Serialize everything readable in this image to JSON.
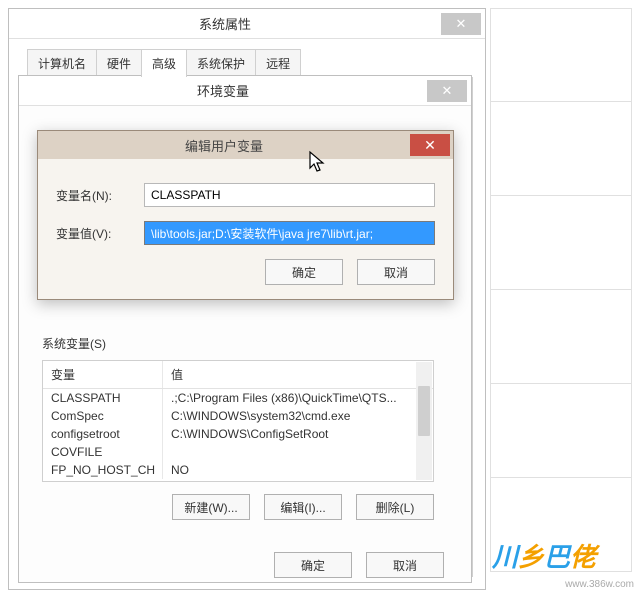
{
  "win1": {
    "title": "系统属性",
    "tabs": [
      "计算机名",
      "硬件",
      "高级",
      "系统保护",
      "远程"
    ],
    "active_tab": 2
  },
  "win2": {
    "title": "环境变量"
  },
  "win3": {
    "title": "编辑用户变量",
    "name_label": "变量名(N):",
    "name_value": "CLASSPATH",
    "value_label": "变量值(V):",
    "value_value": "\\lib\\tools.jar;D:\\安装软件\\java jre7\\lib\\rt.jar;",
    "ok": "确定",
    "cancel": "取消"
  },
  "sysvars": {
    "label": "系统变量(S)",
    "headers": {
      "var": "变量",
      "val": "值"
    },
    "rows": [
      {
        "var": "CLASSPATH",
        "val": ".;C:\\Program Files (x86)\\QuickTime\\QTS..."
      },
      {
        "var": "ComSpec",
        "val": "C:\\WINDOWS\\system32\\cmd.exe"
      },
      {
        "var": "configsetroot",
        "val": "C:\\WINDOWS\\ConfigSetRoot"
      },
      {
        "var": "COVFILE",
        "val": ""
      },
      {
        "var": "FP_NO_HOST_CH",
        "val": "NO"
      }
    ],
    "new_btn": "新建(W)...",
    "edit_btn": "编辑(I)...",
    "del_btn": "删除(L)"
  },
  "env_buttons": {
    "ok": "确定",
    "cancel": "取消"
  },
  "watermark": "www.386w.com",
  "logo": {
    "part1": "乡",
    "part2": "巴",
    "part3": "佬"
  }
}
